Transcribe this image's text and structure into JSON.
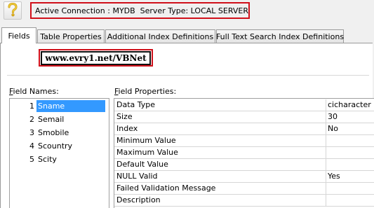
{
  "connection": {
    "active_connection": "Active Connection : MYDB",
    "server_type": "Server Type: LOCAL SERVER",
    "help_icon": "question-mark-icon"
  },
  "tabs": [
    {
      "label": "Fields",
      "active": true
    },
    {
      "label": "Table Properties",
      "active": false
    },
    {
      "label": "Additional Index Definitions",
      "active": false
    },
    {
      "label": "Full Text Search Index Definitions",
      "active": false
    }
  ],
  "watermark": "www.evry1.net/VBNet",
  "field_names": {
    "label_underlined": "F",
    "label_rest": "ield Names:",
    "items": [
      {
        "num": "1",
        "name": "Sname",
        "selected": true
      },
      {
        "num": "2",
        "name": "Semail",
        "selected": false
      },
      {
        "num": "3",
        "name": "Smobile",
        "selected": false
      },
      {
        "num": "4",
        "name": "Scountry",
        "selected": false
      },
      {
        "num": "5",
        "name": "Scity",
        "selected": false
      }
    ]
  },
  "field_properties": {
    "label_underlined": "F",
    "label_rest": "ield Properties:",
    "rows": [
      {
        "name": "Data Type",
        "value": "cicharacter"
      },
      {
        "name": "Size",
        "value": "30"
      },
      {
        "name": "Index",
        "value": "No"
      },
      {
        "name": "Minimum Value",
        "value": ""
      },
      {
        "name": "Maximum Value",
        "value": ""
      },
      {
        "name": "Default Value",
        "value": ""
      },
      {
        "name": "NULL Valid",
        "value": "Yes"
      },
      {
        "name": "Failed Validation Message",
        "value": ""
      },
      {
        "name": "Description",
        "value": ""
      }
    ]
  },
  "colors": {
    "highlight_border": "#d0101a",
    "selection": "#3399ff"
  }
}
